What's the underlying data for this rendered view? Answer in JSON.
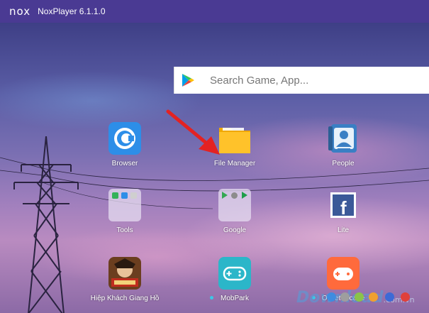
{
  "window": {
    "logo": "nox",
    "title": "NoxPlayer 6.1.1.0"
  },
  "search": {
    "placeholder": "Search Game, App..."
  },
  "apps": [
    {
      "label": "Browser",
      "icon": "browser-icon"
    },
    {
      "label": "File Manager",
      "icon": "folder-icon"
    },
    {
      "label": "People",
      "icon": "contacts-icon"
    },
    {
      "label": "Tools",
      "icon": "tools-folder-icon"
    },
    {
      "label": "Google",
      "icon": "google-folder-icon"
    },
    {
      "label": "Lite",
      "icon": "facebook-icon"
    },
    {
      "label": "Hiệp Khách Giang Hồ",
      "icon": "game-icon"
    },
    {
      "label": "MobPark",
      "icon": "gamepad-icon"
    },
    {
      "label": "Omlet Arcade",
      "icon": "omlet-icon"
    }
  ],
  "watermark": {
    "text": "Download",
    "suffix": ".com.vn"
  },
  "colors": {
    "titlebar": "#4a3a93",
    "arrow": "#e32222",
    "new_dot": "#3cc7e6"
  }
}
